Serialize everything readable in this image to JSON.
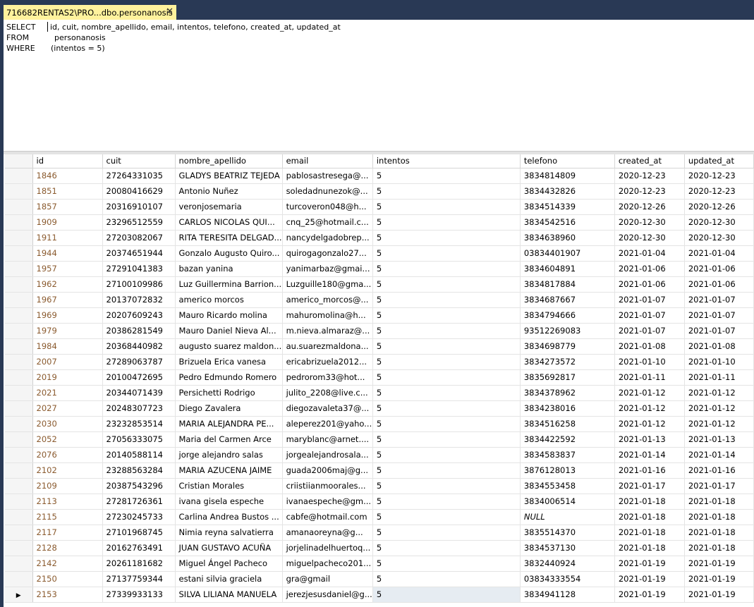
{
  "tab": {
    "title": "716682RENTAS2\\PRO...dbo.personanosis",
    "close_glyph": "✕"
  },
  "query": {
    "select_kw": "SELECT",
    "select_cols": "id, cuit, nombre_apellido, email, intentos, telefono, created_at, updated_at",
    "from_kw": "FROM",
    "from_table": "personanosis",
    "where_kw": "WHERE",
    "where_cond": "(intentos = 5)"
  },
  "grid": {
    "current_row_glyph": "▶",
    "columns": [
      "id",
      "cuit",
      "nombre_apellido",
      "email",
      "intentos",
      "telefono",
      "created_at",
      "updated_at"
    ],
    "rows": [
      [
        "1846",
        "27264331035",
        "GLADYS BEATRIZ TEJEDA",
        "pablosastresega@...",
        "5",
        "3834814809",
        "2020-12-23",
        "2020-12-23"
      ],
      [
        "1851",
        "20080416629",
        "Antonio Nuñez",
        "soledadnunezok@...",
        "5",
        "3834432826",
        "2020-12-23",
        "2020-12-23"
      ],
      [
        "1857",
        "20316910107",
        "veronjosemaria",
        "turcoveron048@h...",
        "5",
        "3834514339",
        "2020-12-26",
        "2020-12-26"
      ],
      [
        "1909",
        "23296512559",
        "CARLOS NICOLAS QUI...",
        "cnq_25@hotmail.c...",
        "5",
        "3834542516",
        "2020-12-30",
        "2020-12-30"
      ],
      [
        "1911",
        "27203082067",
        "RITA TERESITA DELGAD...",
        "nancydelgadobrep...",
        "5",
        "3834638960",
        "2020-12-30",
        "2020-12-30"
      ],
      [
        "1944",
        "20374651944",
        "Gonzalo Augusto Quiro...",
        "quirogagonzalo27...",
        "5",
        "03834401907",
        "2021-01-04",
        "2021-01-04"
      ],
      [
        "1957",
        "27291041383",
        "bazan yanina",
        "yanimarbaz@gmai...",
        "5",
        "3834604891",
        "2021-01-06",
        "2021-01-06"
      ],
      [
        "1962",
        "27100109986",
        "Luz Guillermina Barrion...",
        "Luzguille180@gma...",
        "5",
        "3834817884",
        "2021-01-06",
        "2021-01-06"
      ],
      [
        "1967",
        "20137072832",
        "americo morcos",
        "americo_morcos@...",
        "5",
        "3834687667",
        "2021-01-07",
        "2021-01-07"
      ],
      [
        "1969",
        "20207609243",
        "Mauro Ricardo molina",
        "mahuromolina@h...",
        "5",
        "3834794666",
        "2021-01-07",
        "2021-01-07"
      ],
      [
        "1979",
        "20386281549",
        "Mauro Daniel Nieva Al...",
        "m.nieva.almaraz@...",
        "5",
        "93512269083",
        "2021-01-07",
        "2021-01-07"
      ],
      [
        "1984",
        "20368440982",
        "augusto suarez maldon...",
        "au.suarezmaldona...",
        "5",
        "3834698779",
        "2021-01-08",
        "2021-01-08"
      ],
      [
        "2007",
        "27289063787",
        "Brizuela Erica vanesa",
        "ericabrizuela2012...",
        "5",
        "3834273572",
        "2021-01-10",
        "2021-01-10"
      ],
      [
        "2019",
        "20100472695",
        "Pedro Edmundo Romero",
        "pedrorom33@hot...",
        "5",
        "3835692817",
        "2021-01-11",
        "2021-01-11"
      ],
      [
        "2021",
        "20344071439",
        "Persichetti Rodrigo",
        "julito_2208@live.c...",
        "5",
        "3834378962",
        "2021-01-12",
        "2021-01-12"
      ],
      [
        "2027",
        "20248307723",
        "Diego Zavalera",
        "diegozavaleta37@...",
        "5",
        "3834238016",
        "2021-01-12",
        "2021-01-12"
      ],
      [
        "2030",
        "23232853514",
        "MARIA ALEJANDRA PE...",
        "aleperez201@yaho...",
        "5",
        "3834516258",
        "2021-01-12",
        "2021-01-12"
      ],
      [
        "2052",
        "27056333075",
        "Maria del Carmen Arce",
        "maryblanc@arnet....",
        "5",
        "3834422592",
        "2021-01-13",
        "2021-01-13"
      ],
      [
        "2076",
        "20140588114",
        "jorge alejandro salas",
        "jorgealejandrosala...",
        "5",
        "3834583837",
        "2021-01-14",
        "2021-01-14"
      ],
      [
        "2102",
        "23288563284",
        "MARIA AZUCENA JAIME",
        "guada2006maj@g...",
        "5",
        "3876128013",
        "2021-01-16",
        "2021-01-16"
      ],
      [
        "2109",
        "20387543296",
        "Cristian Morales",
        "criistiianmoorales...",
        "5",
        "3834553458",
        "2021-01-17",
        "2021-01-17"
      ],
      [
        "2113",
        "27281726361",
        "ivana gisela espeche",
        "ivanaespeche@gm...",
        "5",
        "3834006514",
        "2021-01-18",
        "2021-01-18"
      ],
      [
        "2115",
        "27230245733",
        "Carlina Andrea Bustos ...",
        "cabfe@hotmail.com",
        "5",
        "NULL",
        "2021-01-18",
        "2021-01-18"
      ],
      [
        "2117",
        "27101968745",
        "Nimia reyna salvatierra",
        "amanaoreyna@g...",
        "5",
        "3835514370",
        "2021-01-18",
        "2021-01-18"
      ],
      [
        "2128",
        "20162763491",
        "JUAN GUSTAVO ACUÑA",
        "jorjelinadelhuertoq...",
        "5",
        "3834537130",
        "2021-01-18",
        "2021-01-18"
      ],
      [
        "2142",
        "20261181682",
        "Miguel Ángel  Pacheco",
        "miguelpacheco201...",
        "5",
        "3832440924",
        "2021-01-19",
        "2021-01-19"
      ],
      [
        "2150",
        "27137759344",
        "estani silvia graciela",
        "gra@gmail",
        "5",
        "03834333554",
        "2021-01-19",
        "2021-01-19"
      ],
      [
        "2153",
        "27339933133",
        "SILVA LILIANA MANUELA",
        "jerezjesusdaniel@g...",
        "5",
        "3834941128",
        "2021-01-19",
        "2021-01-19"
      ]
    ]
  }
}
